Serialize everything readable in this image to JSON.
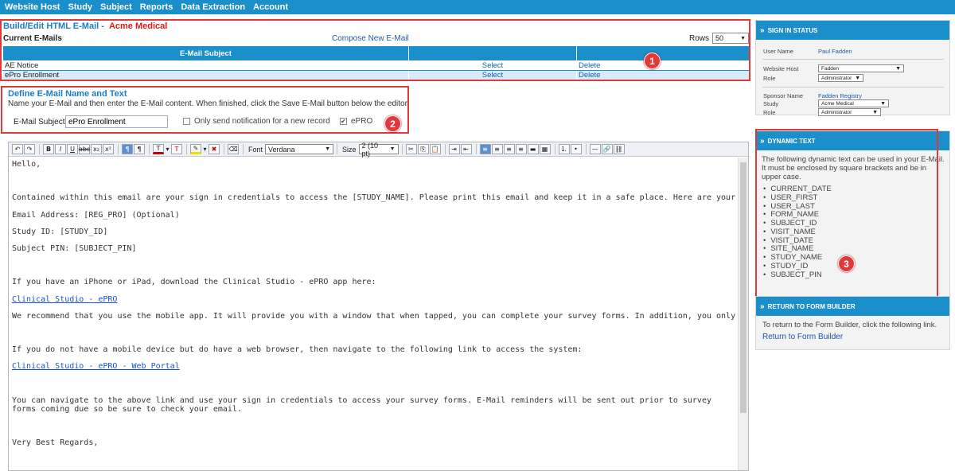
{
  "nav": [
    "Website Host",
    "Study",
    "Subject",
    "Reports",
    "Data Extraction",
    "Account"
  ],
  "build": {
    "title": "Build/Edit HTML E-Mail -",
    "org": "Acme Medical",
    "current_emails": "Current E-Mails",
    "compose_link": "Compose New E-Mail",
    "rows_label": "Rows",
    "rows_value": "50",
    "table": {
      "header": "E-Mail Subject",
      "rows": [
        {
          "subject": "AE Notice",
          "select": "Select",
          "delete": "Delete"
        },
        {
          "subject": "ePro Enrollment",
          "select": "Select",
          "delete": "Delete"
        }
      ]
    }
  },
  "define": {
    "title": "Define E-Mail Name and Text",
    "help": "Name your E-Mail and then enter the E-Mail content. When finished, click the Save E-Mail button below the editor.",
    "subject_label": "E-Mail Subject",
    "subject_value": "ePro Enrollment",
    "only_send_label": "Only send notification for a new record",
    "only_send_checked": false,
    "epro_label": "ePRO",
    "epro_checked": true
  },
  "toolbar": {
    "font_label": "Font",
    "font_value": "Verdana",
    "size_label": "Size",
    "size_value": "2 (10 pt)",
    "text_color": "#cc0000",
    "highlight_color": "#f0e000"
  },
  "editor": {
    "lines": [
      "Hello,",
      "",
      "Contained within this email are your sign in credentials to access the [STUDY_NAME]. Please print this email and keep it in a safe place. Here are your Sign In credentials.",
      "Email Address: [REG_PRO] (Optional)",
      "Study ID: [STUDY_ID]",
      "Subject PIN: [SUBJECT_PIN]",
      "",
      "If you have an iPhone or iPad, download the Clinical Studio - ePRO app here:",
      "Clinical Studio - ePRO",
      "We recommend that you use the mobile app. It will provide you with a window that when tapped, you can complete your survey forms. In addition, you only need to Sign In once.",
      "",
      "If you do not have a mobile device but do have a web browser, then navigate to the following link to access the system:",
      "Clinical Studio - ePRO - Web Portal",
      "",
      "You can navigate to the above link and use your sign in credentials to access your survey forms. E-Mail reminders will be sent out prior to survey forms coming due so be sure to check your email.",
      "",
      "Very Best Regards,"
    ]
  },
  "signin": {
    "title": "SIGN IN STATUS",
    "user_name_label": "User Name",
    "user_name": "Paul Fadden",
    "website_host_label": "Website Host",
    "website_host": "Fadden",
    "role_label": "Role",
    "role": "Administrator",
    "sponsor_name_label": "Sponsor Name",
    "sponsor_name": "Fadden Registry",
    "study_label": "Study",
    "study": "Acme Medical",
    "role2_label": "Role",
    "role2": "Administrator"
  },
  "dynamic": {
    "title": "DYNAMIC TEXT",
    "intro": "The following dynamic text can be used in your E-Mail. It must be enclosed by square brackets and be in upper case.",
    "items": [
      "CURRENT_DATE",
      "USER_FIRST",
      "USER_LAST",
      "FORM_NAME",
      "SUBJECT_ID",
      "VISIT_NAME",
      "VISIT_DATE",
      "SITE_NAME",
      "STUDY_NAME",
      "STUDY_ID",
      "SUBJECT_PIN"
    ]
  },
  "return": {
    "title": "RETURN TO FORM BUILDER",
    "text": "To return to the Form Builder, click the following link.",
    "link": "Return to Form Builder"
  },
  "callouts": [
    "1",
    "2",
    "3"
  ],
  "colors": {
    "accent": "#1a8fc9",
    "callout": "#e0393b",
    "brand_red": "#e0191b"
  }
}
